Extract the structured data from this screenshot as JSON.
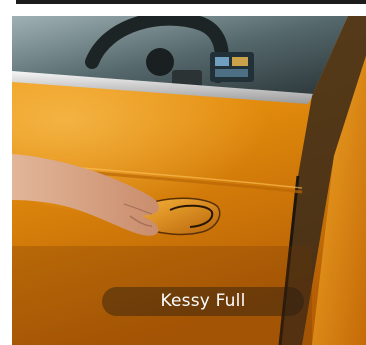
{
  "image": {
    "subject": "car-door-handle-photo"
  },
  "feature_card": {
    "caption": "Kessy Full"
  },
  "colors": {
    "car_paint": "#e3900f",
    "caption_background": "#281c10",
    "caption_text": "#ffffff"
  }
}
